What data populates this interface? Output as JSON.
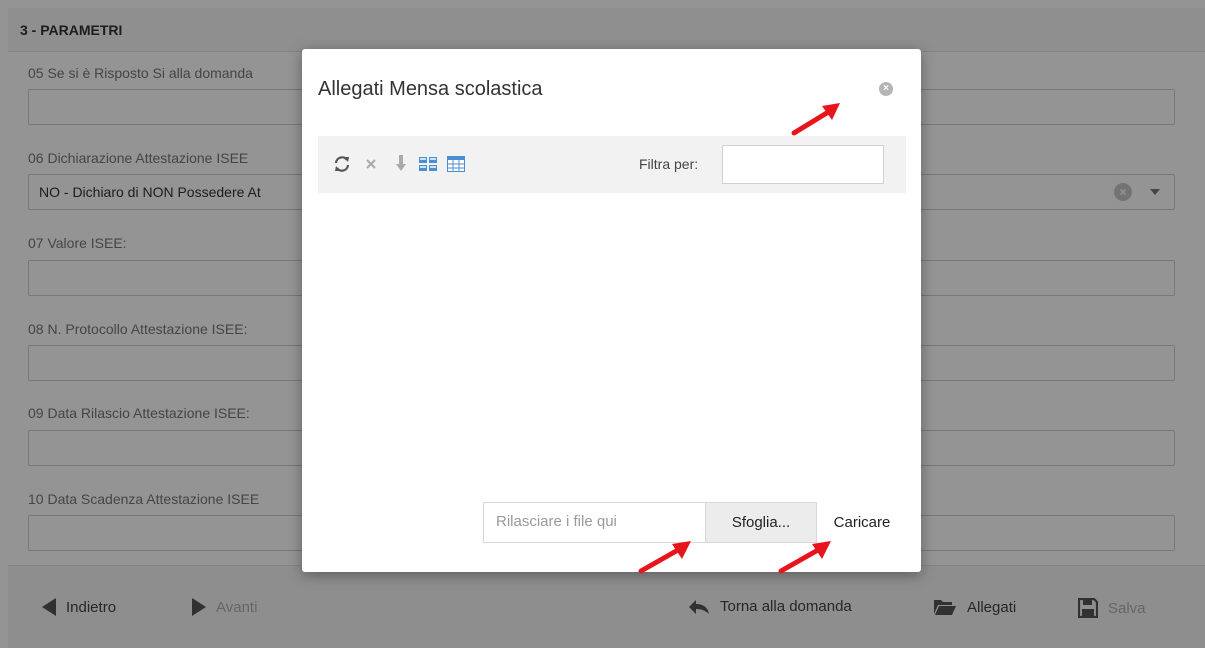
{
  "form": {
    "section_title": "3 - PARAMETRI",
    "fields": [
      {
        "label": "05 Se si è Risposto Si alla domanda"
      },
      {
        "label": "06 Dichiarazione Attestazione ISEE",
        "value": "NO - Dichiaro di NON Possedere At"
      },
      {
        "label": "07 Valore ISEE:"
      },
      {
        "label": "08 N. Protocollo Attestazione ISEE:"
      },
      {
        "label": "09 Data Rilascio Attestazione ISEE:"
      },
      {
        "label": "10 Data Scadenza Attestazione ISEE"
      }
    ]
  },
  "bottom_bar": {
    "back": "Indietro",
    "next": "Avanti",
    "return": "Torna alla domanda",
    "attachments": "Allegati",
    "save": "Salva"
  },
  "modal": {
    "title": "Allegati Mensa scolastica",
    "filter_label": "Filtra per:",
    "filter_value": "",
    "drop_placeholder": "Rilasciare i file qui",
    "browse_label": "Sfoglia...",
    "upload_label": "Caricare",
    "toolbar_icons": [
      "refresh-icon",
      "delete-icon",
      "download-icon",
      "grid-view-icon",
      "table-view-icon"
    ]
  },
  "colors": {
    "overlay": "#00000069",
    "annotation_arrow": "#e8141c",
    "table_icon": "#4a8fd4"
  }
}
